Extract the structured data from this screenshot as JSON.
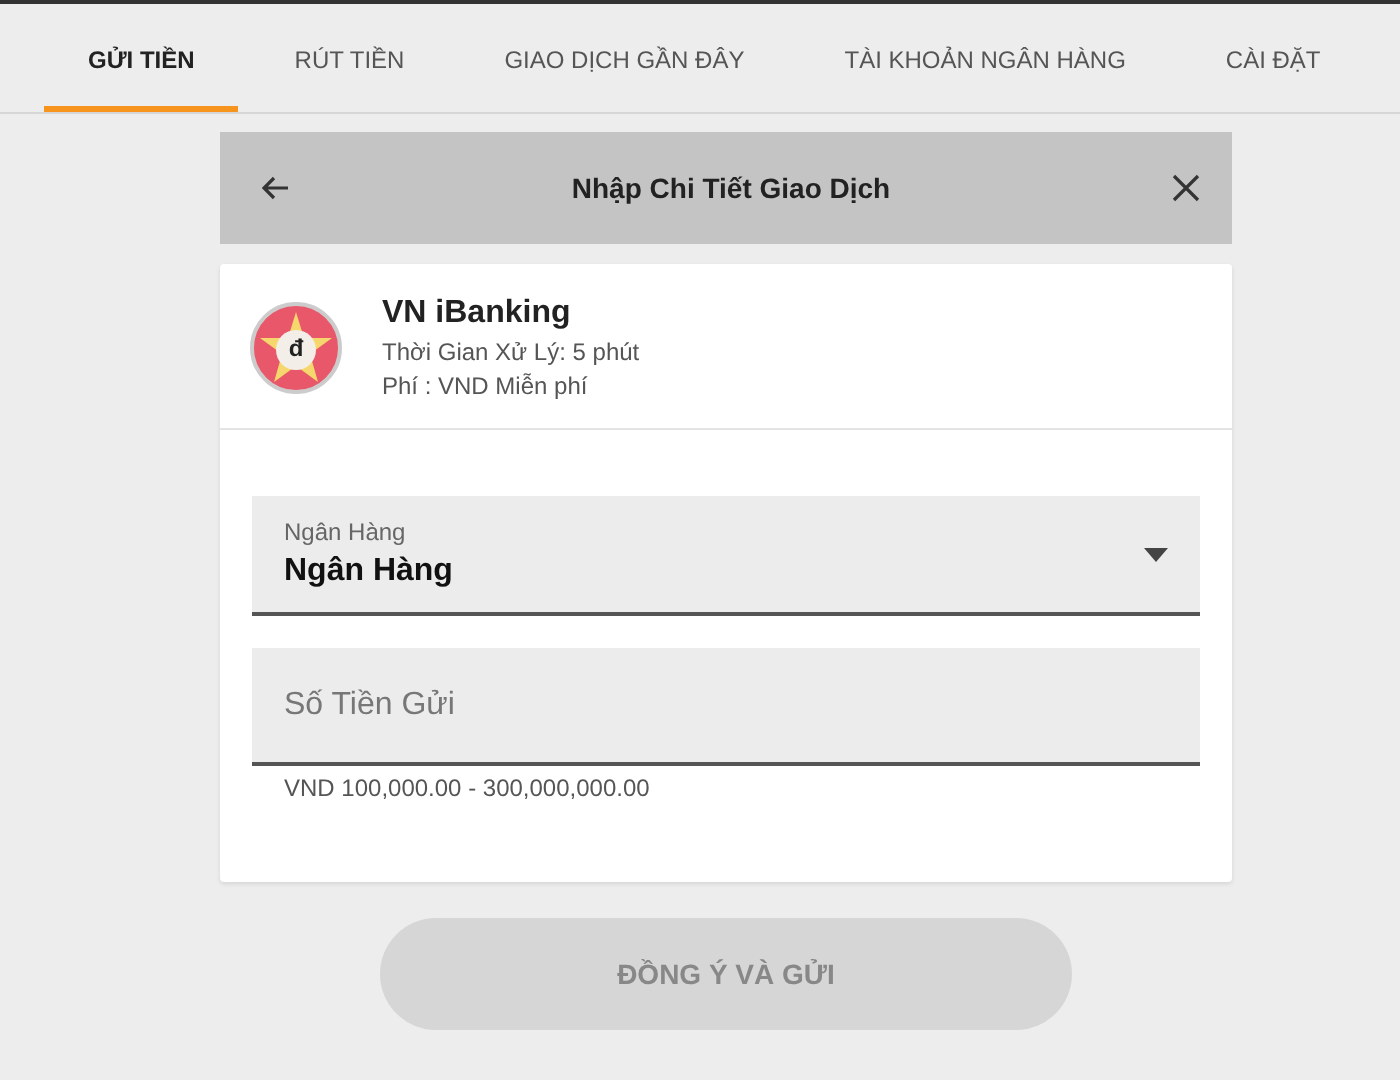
{
  "tabs": [
    {
      "label": "GỬI TIỀN",
      "selected": true
    },
    {
      "label": "RÚT TIỀN",
      "selected": false
    },
    {
      "label": "GIAO DỊCH GẦN ĐÂY",
      "selected": false
    },
    {
      "label": "TÀI KHOẢN NGÂN HÀNG",
      "selected": false
    },
    {
      "label": "CÀI ĐẶT",
      "selected": false
    }
  ],
  "dialog": {
    "title": "Nhập Chi Tiết Giao Dịch",
    "method": {
      "logo_symbol": "đ",
      "name": "VN iBanking",
      "processing_time": "Thời Gian Xử Lý: 5 phút",
      "fee": "Phí : VND Miễn phí"
    },
    "bank_select": {
      "label": "Ngân Hàng",
      "value": "Ngân Hàng"
    },
    "amount_field": {
      "placeholder": "Số Tiền Gửi",
      "hint": "VND 100,000.00 - 300,000,000.00"
    },
    "submit_button": {
      "label": "ĐỒNG Ý VÀ GỬI",
      "disabled": true
    }
  }
}
